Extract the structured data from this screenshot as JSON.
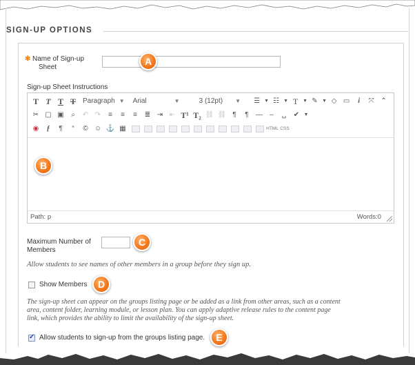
{
  "section": {
    "title": "SIGN-UP OPTIONS"
  },
  "form": {
    "name_label_line1": "Name of Sign-up",
    "name_label_line2": "Sheet",
    "required_marker": "✱",
    "name_value": "",
    "instructions_label": "Sign-up Sheet Instructions",
    "max_members_label_line1": "Maximum Number of",
    "max_members_label_line2": "Members",
    "max_members_value": "",
    "allow_names_note": "Allow students to see names of other members in a group before they sign up.",
    "show_members_label": "Show Members",
    "show_members_checked": false,
    "listing_note_line1": "The sign-up sheet can appear on the groups listing page or be added as a link from other areas, such as a content",
    "listing_note_line2": "area, content folder, learning module, or lesson plan. You can apply adaptive release rules to the content page",
    "listing_note_line3": "link, which provides the ability to limit the availability of the sign-up sheet.",
    "allow_listing_label": "Allow students to sign-up from the groups listing page.",
    "allow_listing_checked": true
  },
  "editor": {
    "toolbar_row1": {
      "format_buttons": [
        "T",
        "T",
        "T",
        "T"
      ],
      "paragraph_select": "Paragraph",
      "font_select": "Arial",
      "size_select": "3 (12pt)"
    },
    "toolbar_row2": {
      "superscript": "T¹",
      "subscript": "T₂"
    },
    "toolbar_row3": {
      "html_button": "HTML",
      "css_button": "CSS"
    },
    "path_label": "Path: p",
    "words_label": "Words:0"
  },
  "markers": {
    "a": "A",
    "b": "B",
    "c": "C",
    "d": "D",
    "e": "E"
  },
  "colors": {
    "marker_orange": "#f47a1f",
    "required_orange": "#f28a1e",
    "border_gray": "#cfcfcf"
  }
}
